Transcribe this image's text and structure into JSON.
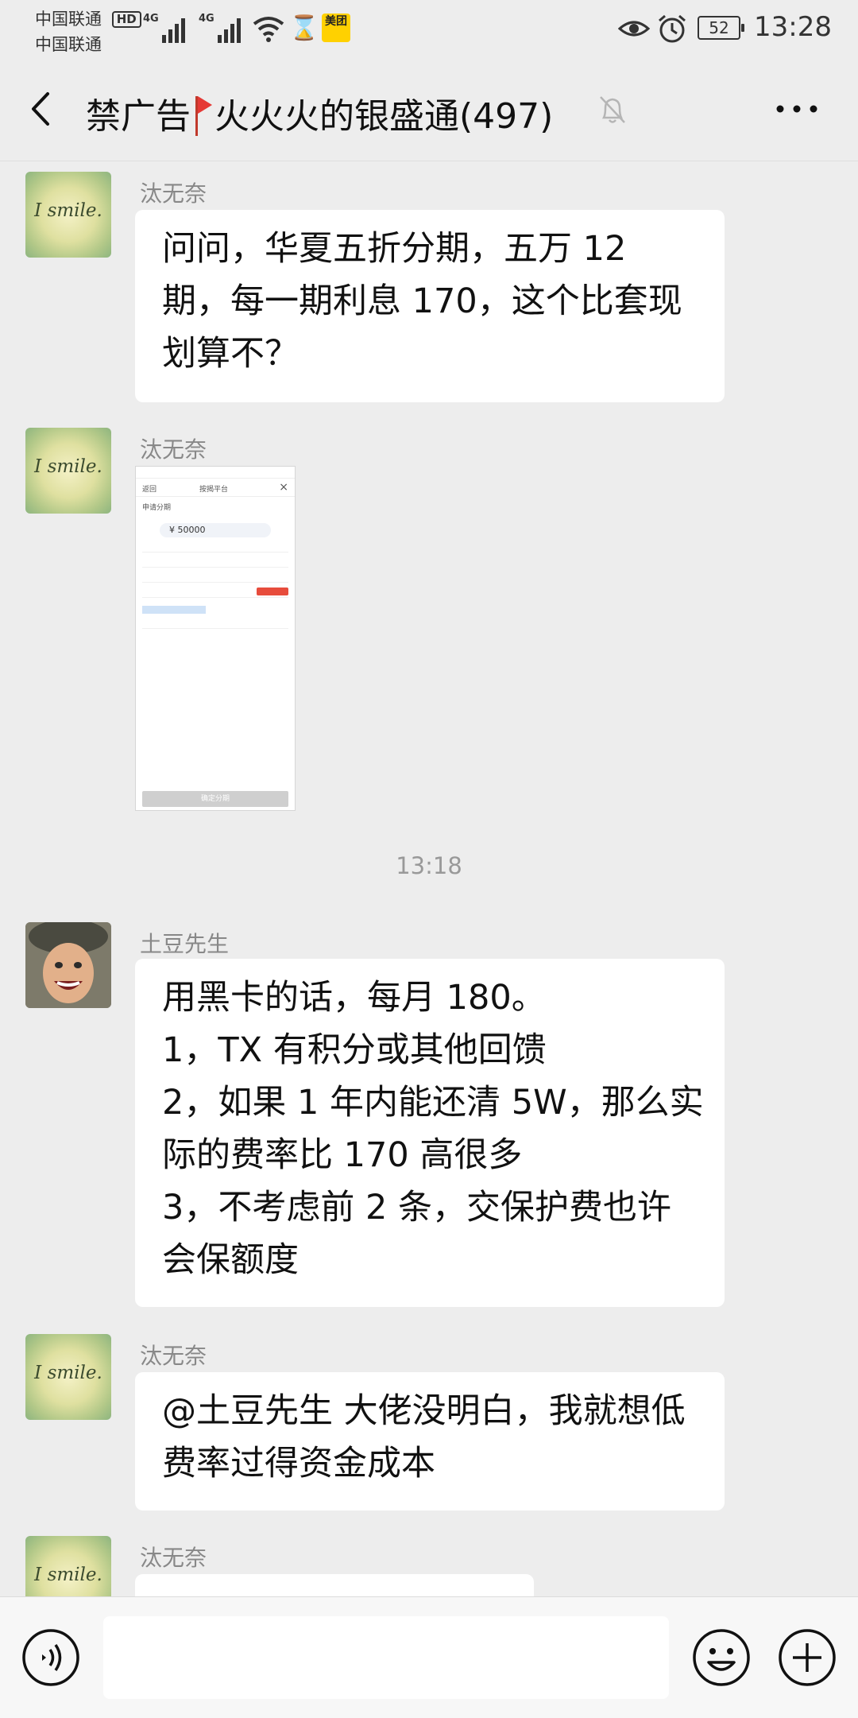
{
  "status_bar": {
    "carrier1": "中国联通",
    "carrier2": "中国联通",
    "hd_badge": "HD",
    "signal1_label": "4G",
    "signal2_label": "4G",
    "meituan_label": "美团",
    "battery": "52",
    "time": "13:28",
    "icons": [
      "signal-icon",
      "wifi-icon",
      "hourglass-icon",
      "meituan-app-icon",
      "eye-icon",
      "alarm-icon",
      "battery-icon"
    ]
  },
  "nav": {
    "title_prefix": "禁广告",
    "title_main": "火火火的银盛通(497)",
    "back_icon": "chevron-left-icon",
    "mute_icon": "bell-off-icon",
    "more_icon": "more-dots-icon"
  },
  "messages": [
    {
      "sender": "汰无奈",
      "avatar_text": "I smile.",
      "lines": [
        "问问，华夏五折分期，五万 12 期，每一期利息 170，这个比套现划算不？"
      ]
    },
    {
      "sender": "汰无奈",
      "avatar_text": "I smile.",
      "type": "image",
      "image": {
        "back_label": "返回",
        "title": "按揭平台",
        "section": "申请分期",
        "amount": "¥ 50000",
        "confirm_button": "确定分期"
      }
    },
    {
      "sender": "土豆先生",
      "lines": [
        "用黑卡的话，每月 180。",
        "1，TX 有积分或其他回馈",
        "2，如果 1 年内能还清 5W，那么实际的费率比 170 高很多",
        "3，不考虑前 2 条，交保护费也许会保额度"
      ]
    },
    {
      "sender": "汰无奈",
      "avatar_text": "I smile.",
      "lines": [
        "@土豆先生  大佬没明白，我就想低费率过得资金成本"
      ]
    },
    {
      "sender": "汰无奈",
      "avatar_text": "I smile."
    }
  ],
  "timestamp": "13:18",
  "input_bar": {
    "voice_icon": "voice-icon",
    "input_value": "",
    "emoji_icon": "emoji-icon",
    "plus_icon": "plus-icon"
  }
}
